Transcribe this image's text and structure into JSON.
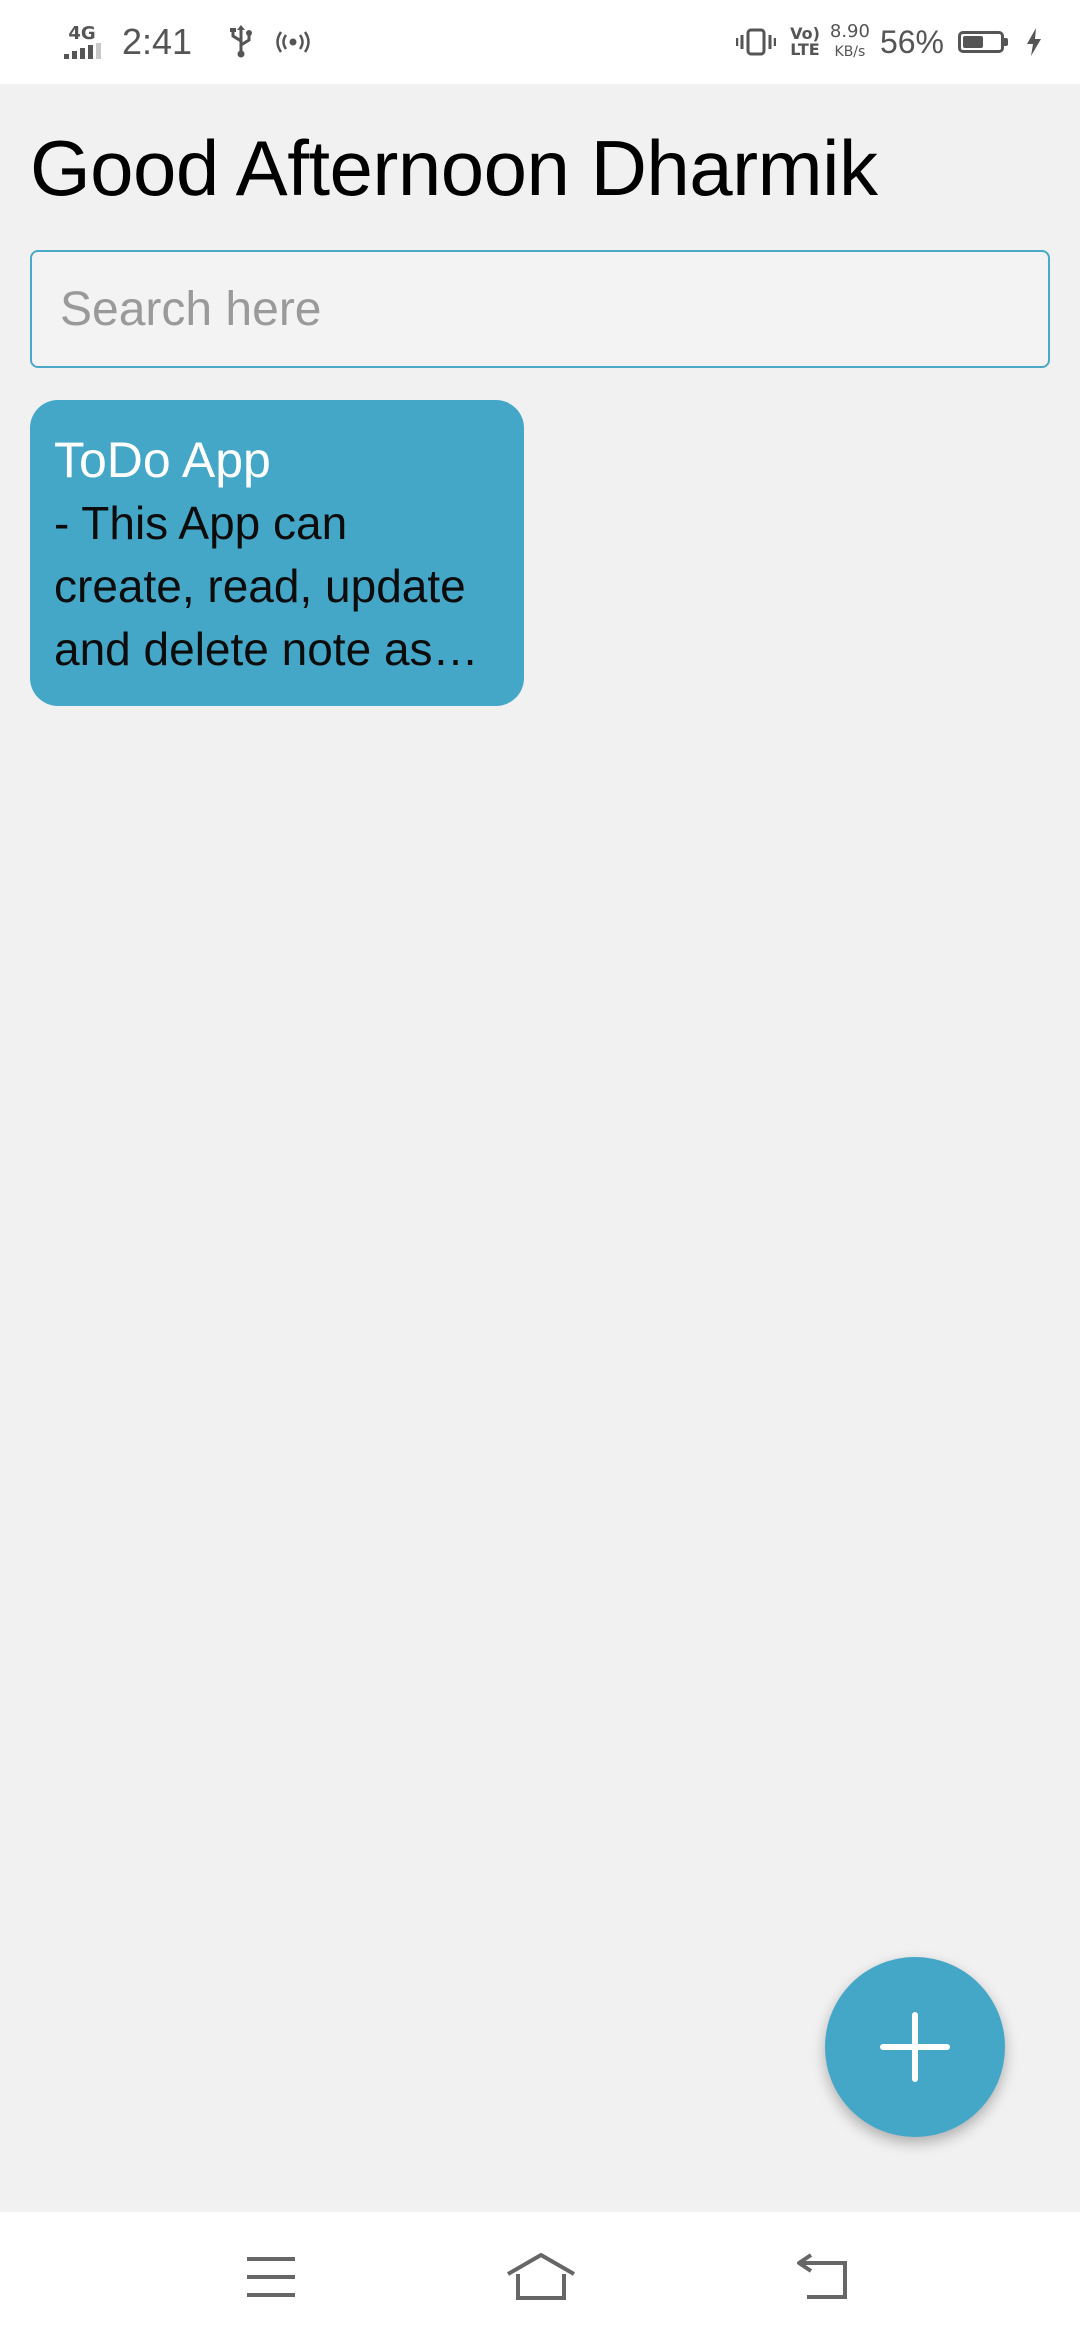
{
  "status_bar": {
    "network_type": "4G",
    "time": "2:41",
    "volte_top": "Vo)",
    "volte_bottom": "LTE",
    "speed_value": "8.90",
    "speed_unit": "KB/s",
    "battery_percent": "56%",
    "battery_level": 0.56,
    "icons": [
      "signal-icon",
      "usb-icon",
      "hotspot-icon",
      "vibrate-icon",
      "volte-icon",
      "battery-icon",
      "charging-icon"
    ]
  },
  "header": {
    "greeting": "Good Afternoon Dharmik"
  },
  "search": {
    "placeholder": "Search here",
    "value": ""
  },
  "notes": [
    {
      "title": "ToDo App",
      "body": "- This App can create, read, update and delete note as per the user requirement"
    }
  ],
  "fab": {
    "icon": "plus-icon"
  },
  "nav_bar": {
    "icons": [
      "menu-icon",
      "home-icon",
      "back-icon"
    ]
  },
  "colors": {
    "accent": "#45a7c8",
    "background": "#f1f1f1",
    "status_bar": "#ffffff",
    "text_primary": "#000000"
  }
}
